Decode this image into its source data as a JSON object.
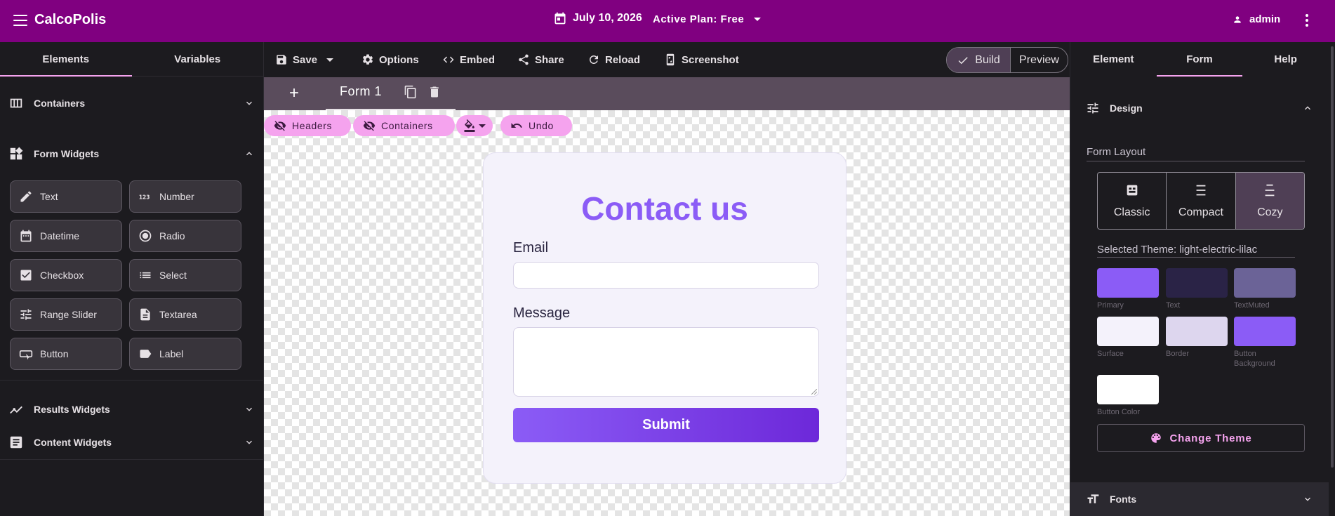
{
  "app": {
    "title": "CalcoPolis"
  },
  "header": {
    "date": "July 10, 2026",
    "plan": "Active Plan: Free",
    "user": "admin"
  },
  "left_panel": {
    "tabs": [
      {
        "label": "Elements",
        "active": true
      },
      {
        "label": "Variables",
        "active": false
      }
    ],
    "sections": {
      "containers": "Containers",
      "form_widgets": "Form Widgets",
      "results_widgets": "Results Widgets",
      "content_widgets": "Content Widgets"
    },
    "widgets": [
      {
        "label": "Text",
        "icon": "pencil-icon"
      },
      {
        "label": "Number",
        "icon": "number-icon"
      },
      {
        "label": "Datetime",
        "icon": "calendar-icon"
      },
      {
        "label": "Radio",
        "icon": "radio-icon"
      },
      {
        "label": "Checkbox",
        "icon": "checkbox-icon"
      },
      {
        "label": "Select",
        "icon": "list-icon"
      },
      {
        "label": "Range Slider",
        "icon": "sliders-icon"
      },
      {
        "label": "Textarea",
        "icon": "document-icon"
      },
      {
        "label": "Button",
        "icon": "button-icon"
      },
      {
        "label": "Label",
        "icon": "label-icon"
      }
    ]
  },
  "toolbar": {
    "save": "Save",
    "options": "Options",
    "embed": "Embed",
    "share": "Share",
    "reload": "Reload",
    "screenshot": "Screenshot",
    "build": "Build",
    "preview": "Preview"
  },
  "canvas": {
    "form_tab": "Form 1",
    "chips": {
      "headers": "Headers",
      "containers": "Containers",
      "undo": "Undo"
    },
    "form": {
      "title": "Contact us",
      "email_label": "Email",
      "message_label": "Message",
      "submit": "Submit"
    }
  },
  "right_panel": {
    "tabs": [
      {
        "label": "Element",
        "active": false
      },
      {
        "label": "Form",
        "active": true
      },
      {
        "label": "Help",
        "active": false
      }
    ],
    "design_title": "Design",
    "form_layout_label": "Form Layout",
    "layouts": [
      {
        "label": "Classic",
        "selected": false
      },
      {
        "label": "Compact",
        "selected": false
      },
      {
        "label": "Cozy",
        "selected": true
      }
    ],
    "selected_theme": "Selected Theme: light-electric-lilac",
    "swatches": [
      {
        "label": "Primary",
        "color": "#8b5cf6"
      },
      {
        "label": "Text",
        "color": "#2a2346"
      },
      {
        "label": "TextMuted",
        "color": "#6b6397"
      },
      {
        "label": "Surface",
        "color": "#f4f2fb"
      },
      {
        "label": "Border",
        "color": "#ddd6ee"
      },
      {
        "label": "Button Background",
        "color": "#8b5cf6"
      },
      {
        "label": "Button Color",
        "color": "#ffffff"
      }
    ],
    "change_theme": "Change Theme",
    "fonts_title": "Fonts"
  },
  "colors": {
    "header_bg": "#800080",
    "accent_pink": "#f5a3ee",
    "form_title": "#8b5cf6",
    "submit_gradient_start": "#8b5cf6",
    "submit_gradient_end": "#6d28d9"
  }
}
